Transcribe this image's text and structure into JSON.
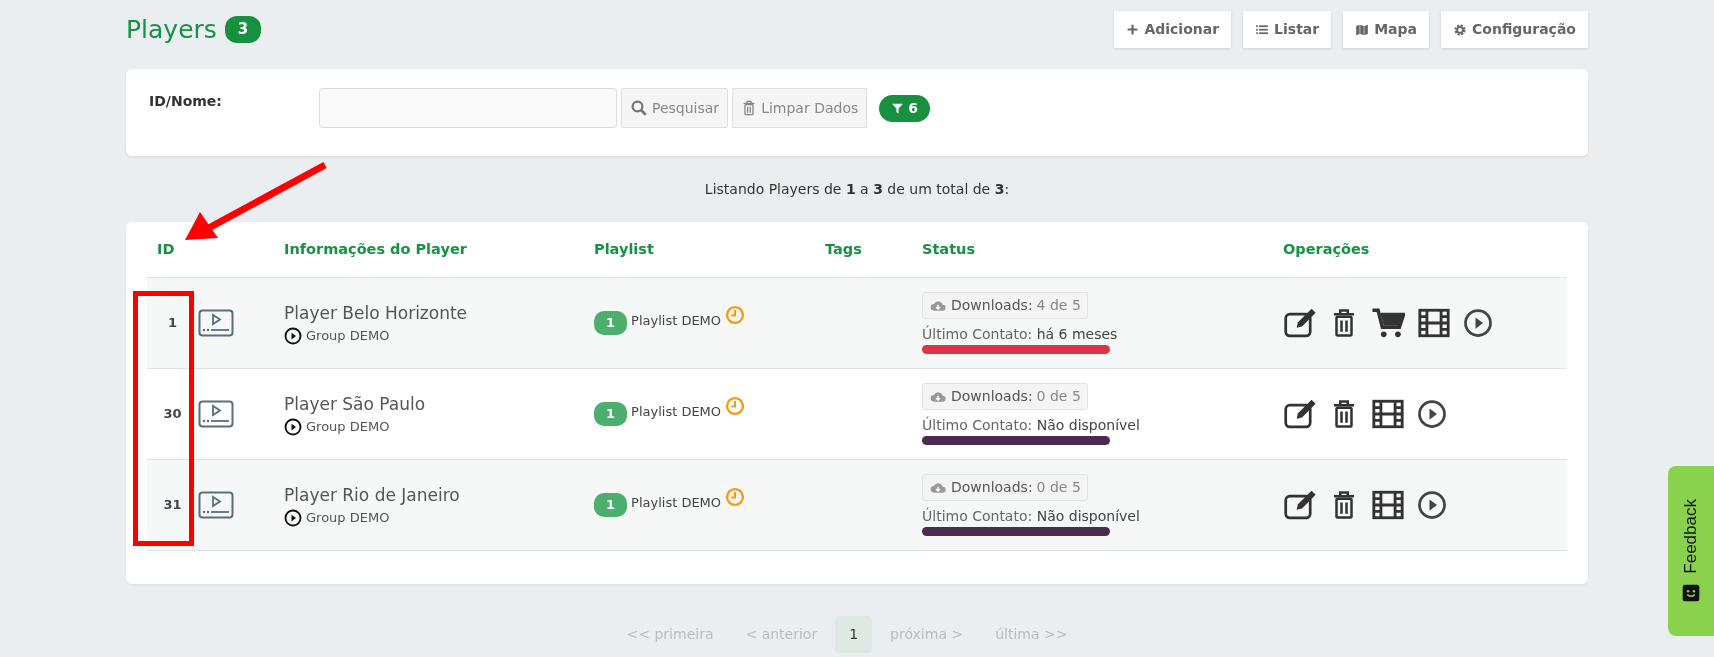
{
  "header": {
    "title": "Players",
    "count": "3",
    "buttons": [
      {
        "kind": "add",
        "label": "Adicionar"
      },
      {
        "kind": "list",
        "label": "Listar"
      },
      {
        "kind": "map",
        "label": "Mapa"
      },
      {
        "kind": "settings",
        "label": "Configuração"
      }
    ]
  },
  "filter": {
    "label": "ID/Nome:",
    "search_button": "Pesquisar",
    "clear_button": "Limpar Dados",
    "filter_count": "6"
  },
  "summary": "Listando Players de **1** a **3** de um total de **3**:",
  "table": {
    "columns": [
      "ID",
      "Informações do Player",
      "Playlist",
      "Tags",
      "Status",
      "Operações"
    ],
    "rows": [
      {
        "id": "1",
        "name": "Player Belo Horizonte",
        "group": "Group DEMO",
        "playlist_count": "1",
        "playlist": "Playlist DEMO",
        "downloads_label": "Downloads:",
        "downloads": "4 de 5",
        "contact_label": "Último Contato:",
        "contact": "há 6 meses",
        "color": "#dc3545",
        "operations": [
          {
            "kind": "edit"
          },
          {
            "kind": "delete"
          },
          {
            "kind": "cart"
          },
          {
            "kind": "film"
          },
          {
            "kind": "play"
          }
        ]
      },
      {
        "id": "30",
        "name": "Player São Paulo",
        "group": "Group DEMO",
        "playlist_count": "1",
        "playlist": "Playlist DEMO",
        "downloads_label": "Downloads:",
        "downloads": "0 de 5",
        "contact_label": "Último Contato:",
        "contact": "Não disponível",
        "color": "#4a2c4f",
        "operations": [
          {
            "kind": "edit"
          },
          {
            "kind": "delete"
          },
          {
            "kind": "film"
          },
          {
            "kind": "play"
          }
        ]
      },
      {
        "id": "31",
        "name": "Player Rio de Janeiro",
        "group": "Group DEMO",
        "playlist_count": "1",
        "playlist": "Playlist DEMO",
        "downloads_label": "Downloads:",
        "downloads": "0 de 5",
        "contact_label": "Último Contato:",
        "contact": "Não disponível",
        "color": "#4a2c4f",
        "operations": [
          {
            "kind": "edit"
          },
          {
            "kind": "delete"
          },
          {
            "kind": "film"
          },
          {
            "kind": "play"
          }
        ]
      }
    ]
  },
  "pagination": [
    {
      "label": "<< primeira",
      "selected": false
    },
    {
      "label": "< anterior",
      "selected": false
    },
    {
      "label": "1",
      "selected": true
    },
    {
      "label": "próxima >",
      "selected": false
    },
    {
      "label": "última >>",
      "selected": false
    }
  ],
  "feedback": "Feedback"
}
